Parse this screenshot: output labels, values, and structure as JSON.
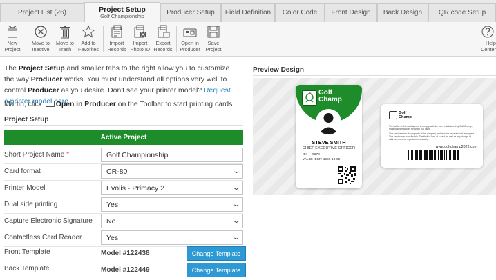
{
  "tabs": [
    {
      "label": "Project List (26)"
    },
    {
      "label": "Project Setup",
      "sublabel": "Golf Championship"
    },
    {
      "label": "Producer Setup"
    },
    {
      "label": "Field Definition"
    },
    {
      "label": "Color Code"
    },
    {
      "label": "Front Design"
    },
    {
      "label": "Back Design"
    },
    {
      "label": "QR code Setup"
    }
  ],
  "toolbar": {
    "new": {
      "line1": "New",
      "line2": "Project",
      "icon": "new-project-icon"
    },
    "inactive": {
      "line1": "Move to",
      "line2": "Inactive",
      "icon": "inactive-icon"
    },
    "trash": {
      "line1": "Move to",
      "line2": "Trash",
      "icon": "trash-icon"
    },
    "favorites": {
      "line1": "Add to",
      "line2": "Favorites",
      "icon": "star-icon"
    },
    "import_records": {
      "line1": "Import",
      "line2": "Records",
      "icon": "import-records-icon"
    },
    "import_photo": {
      "line1": "Import",
      "line2": "Photo ID",
      "icon": "import-photo-icon"
    },
    "export_records": {
      "line1": "Export",
      "line2": "Records",
      "icon": "export-records-icon"
    },
    "open_producer": {
      "line1": "Open in",
      "line2": "Producer",
      "icon": "producer-icon"
    },
    "save": {
      "line1": "Save",
      "line2": "Project",
      "icon": "save-icon"
    },
    "help": {
      "line1": "Help",
      "line2": "Center",
      "icon": "help-icon"
    }
  },
  "intro": {
    "p1": "The ",
    "b1": "Project Setup",
    "p2": " and smaller tabs to the right allow you to customize the way ",
    "b2": "Producer",
    "p3": " works. You must understand all options very well to control ",
    "b3": "Producer",
    "p4": " as you desire. Don't see your printer model? ",
    "link": "Request a printer model here."
  },
  "martin": {
    "p1": "Martin, click ",
    "b1": "Open in Producer",
    "p2": " on the Toolbar to start printing cards."
  },
  "setup": {
    "heading": "Project Setup",
    "active_label": "Active Project",
    "fields": [
      {
        "label": "Short Project Name",
        "value": "Golf Championship",
        "required": "*"
      },
      {
        "label": "Card format",
        "value": "CR-80"
      },
      {
        "label": "Printer Model",
        "value": "Evolis - Primacy 2"
      },
      {
        "label": "Dual side printing",
        "value": "Yes"
      },
      {
        "label": "Capture Electronic Signature",
        "value": "No"
      },
      {
        "label": "Contactless Card Reader",
        "value": "Yes"
      }
    ],
    "templates": [
      {
        "label": "Front Template",
        "model": "Model #122438",
        "button": "Change Template"
      },
      {
        "label": "Back Template",
        "model": "Model #122449",
        "button": "Change Template"
      }
    ]
  },
  "preview": {
    "title": "Preview Design",
    "front": {
      "brand_line1": "Golf",
      "brand_line2": "Champ",
      "name": "STEVE SMITH",
      "position": "CHIEF EXECUTIVE OFFICER",
      "id_label": "ID:",
      "id_value": "5678",
      "valid_label": "VALID:",
      "valid_value": "EXP: 1996-10-02",
      "accent": "#1e8c2a"
    },
    "back": {
      "brand_line1": "Golf",
      "brand_line2": "Champ",
      "text1": "The holder of this card agrees to comply with the rules established by Golf Champ, relating to the activity for which it is used.",
      "text2": "This card remains the property of the company and must be returned to it on request. This card is non-transferable. The theft or loss of a card, as well as any change of address, must be reported immediately.",
      "url": "www.golfchamp2022.com"
    }
  }
}
